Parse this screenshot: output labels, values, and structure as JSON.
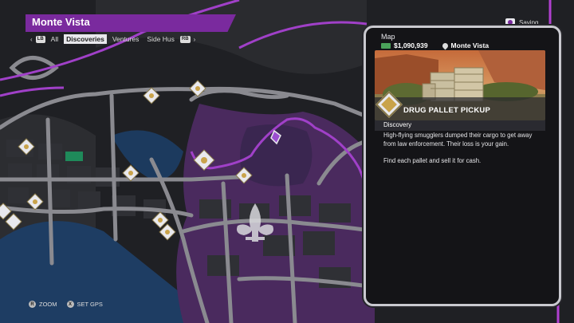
{
  "header": {
    "region_name": "Monte Vista",
    "lb_button": "LB",
    "rb_button": "RB",
    "tabs": [
      {
        "label": "All",
        "active": false
      },
      {
        "label": "Discoveries",
        "active": true
      },
      {
        "label": "Ventures",
        "active": false
      },
      {
        "label": "Side Hus",
        "active": false
      }
    ]
  },
  "status": {
    "saving_label": "Saving",
    "icon": "save-icon"
  },
  "phone": {
    "title": "Map",
    "money": "$1,090,939",
    "location": "Monte Vista",
    "poi": {
      "title": "DRUG PALLET PICKUP",
      "category": "Discovery",
      "description": [
        "High-flying smugglers dumped their cargo to get away from law enforcement. Their loss is your gain.",
        "Find each pallet and sell it for cash."
      ]
    }
  },
  "controls": [
    {
      "button": "R",
      "label": "ZOOM"
    },
    {
      "button": "X",
      "label": "SET GPS"
    }
  ],
  "map_markers": [
    {
      "type": "discovery"
    },
    {
      "type": "discovery"
    },
    {
      "type": "discovery"
    },
    {
      "type": "discovery"
    },
    {
      "type": "discovery"
    },
    {
      "type": "discovery"
    },
    {
      "type": "discovery"
    },
    {
      "type": "discovery"
    },
    {
      "type": "discovery"
    },
    {
      "type": "discovery"
    },
    {
      "type": "discovery"
    }
  ],
  "colors": {
    "accent_purple": "#7a2a9e",
    "road_gray": "#8a8a90",
    "water_blue": "#1e3d63",
    "territory_purple": "#4a2a5e",
    "marker_gold": "#c9a34a",
    "cash_green": "#4aa25a"
  }
}
